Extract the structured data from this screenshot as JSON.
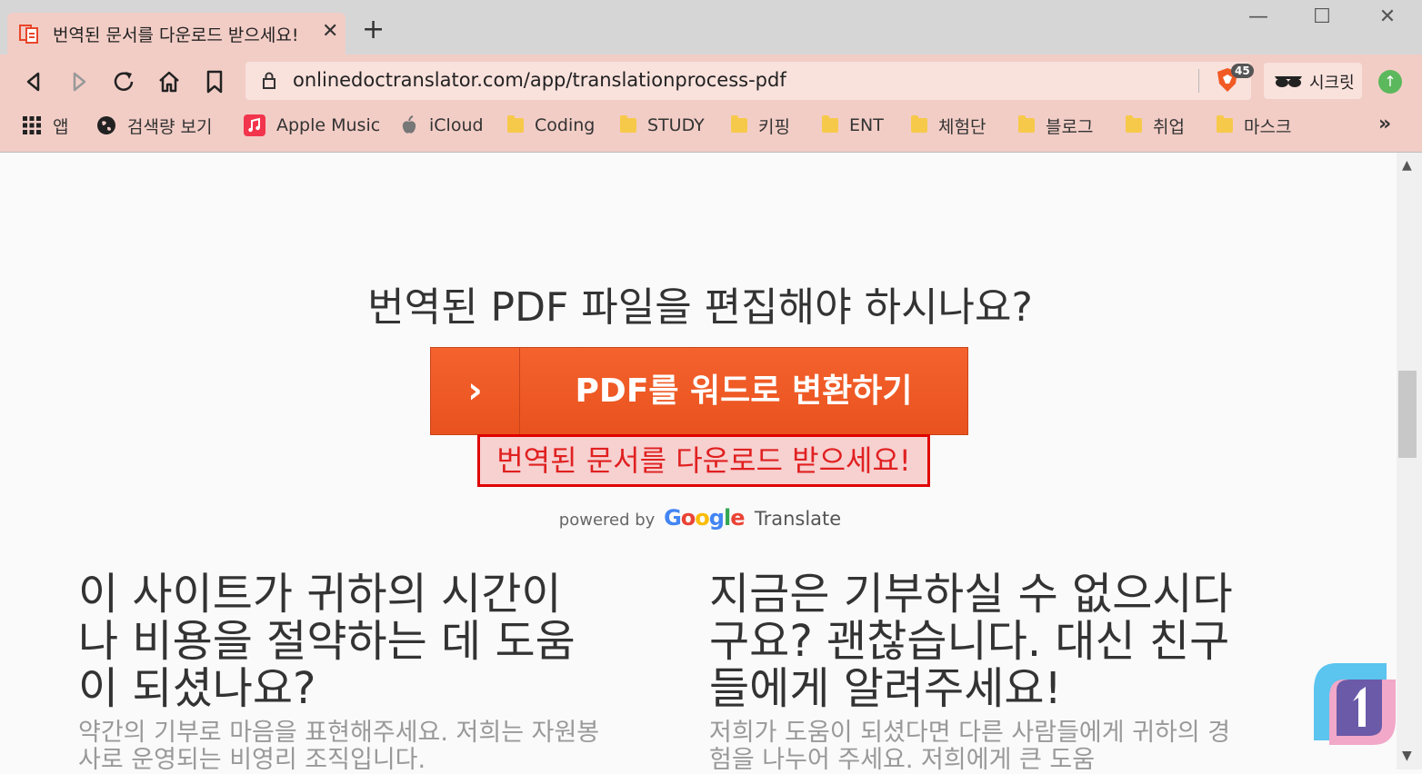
{
  "browser": {
    "tab_title": "번역된 문서를 다운로드 받으세요!",
    "new_tab_label": "+",
    "url": "onlinedoctranslator.com/app/translationprocess-pdf",
    "brave_count": "45",
    "incognito_label": "시크릿",
    "bookmarks": [
      {
        "label": "앱",
        "icon": "apps-grid-icon"
      },
      {
        "label": "검색량 보기",
        "icon": "globe-icon"
      },
      {
        "label": "Apple Music",
        "icon": "music-icon"
      },
      {
        "label": "iCloud",
        "icon": "apple-icon"
      },
      {
        "label": "Coding",
        "icon": "folder-icon"
      },
      {
        "label": "STUDY",
        "icon": "folder-icon"
      },
      {
        "label": "키핑",
        "icon": "folder-icon"
      },
      {
        "label": "ENT",
        "icon": "folder-icon"
      },
      {
        "label": "체험단",
        "icon": "folder-icon"
      },
      {
        "label": "블로그",
        "icon": "folder-icon"
      },
      {
        "label": "취업",
        "icon": "folder-icon"
      },
      {
        "label": "마스크",
        "icon": "folder-icon"
      }
    ],
    "more_bookmarks": "»"
  },
  "page": {
    "headline": "번역된 PDF 파일을 편집해야 하시나요?",
    "cta_label": "PDF를 워드로 변환하기",
    "cta_arrow": "›",
    "download_message": "번역된 문서를 다운로드 받으세요!",
    "powered_by": "powered by",
    "google_letters": [
      "G",
      "o",
      "o",
      "g",
      "l",
      "e"
    ],
    "translate_label": "Translate",
    "left_heading": "이 사이트가 귀하의 시간이 나 비용을 절약하는 데 도움이 되셨나요?",
    "left_text": "약간의 기부로 마음을 표현해주세요. 저희는 자원봉사로 운영되는 비영리 조직입니다.",
    "right_heading": "지금은 기부하실 수 없으시다구요? 괜찮습니다. 대신 친구들에게 알려주세요!",
    "right_text": "저희가 도움이 되셨다면 다른 사람들에게 귀하의 경험을 나누어 주세요. 저희에게 큰 도움"
  },
  "colors": {
    "chrome_bg": "#f2cdc6",
    "cta_orange": "#f4622d",
    "download_border": "#e00000"
  }
}
